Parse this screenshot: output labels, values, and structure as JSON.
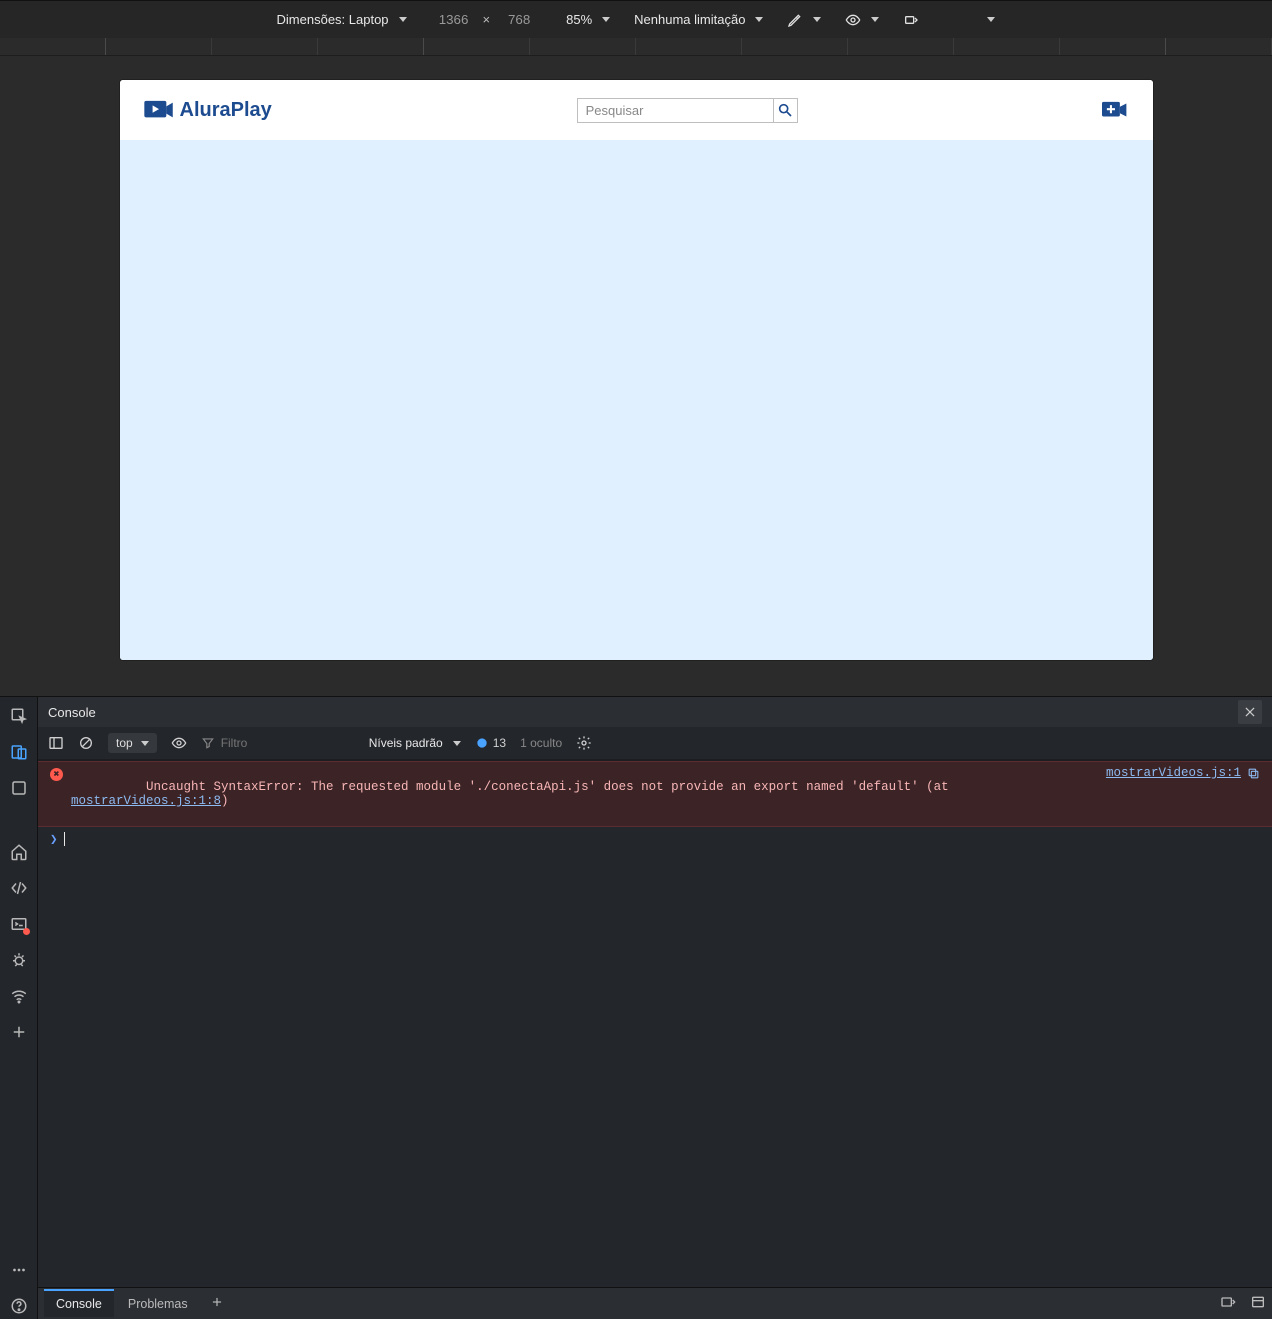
{
  "deviceToolbar": {
    "dimensionsLabel": "Dimensões: Laptop",
    "width": "1366",
    "height": "768",
    "zoom": "85%",
    "throttling": "Nenhuma limitação"
  },
  "page": {
    "logoText": "AluraPlay",
    "searchPlaceholder": "Pesquisar"
  },
  "devtools": {
    "panelTitle": "Console",
    "context": "top",
    "filterPlaceholder": "Filtro",
    "logLevels": "Níveis padrão",
    "issuesCount": "13",
    "hiddenText": "1 oculto",
    "error": {
      "prefix": "Uncaught SyntaxError: The requested module './conectaApi.js' does not provide an export named 'default' (at ",
      "linkInline": "mostrarVideos.js:1:8",
      "suffix": ")",
      "linkRight": "mostrarVideos.js:1"
    },
    "bottomTabs": {
      "console": "Console",
      "problems": "Problemas"
    }
  }
}
